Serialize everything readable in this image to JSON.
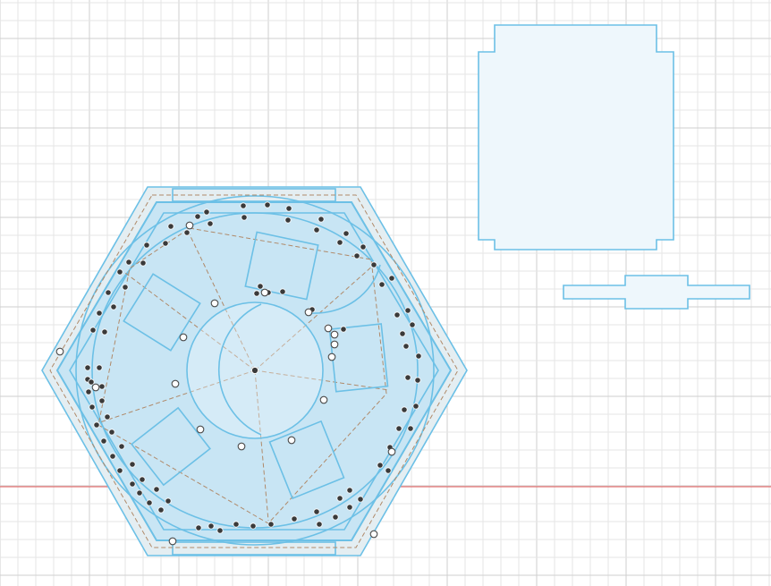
{
  "canvas": {
    "background": "#ffffff",
    "grid_minor_color": "#e6e6e6",
    "grid_major_color": "#cfcfcf",
    "axis_color": "#e57373"
  },
  "sketch": {
    "stroke_color": "#6cc0e6",
    "fill_color": "#bfe2f4",
    "construction_color": "#b08a6a",
    "point_color": "#3a3a3a"
  },
  "icons": [
    "origin-point-icon"
  ]
}
